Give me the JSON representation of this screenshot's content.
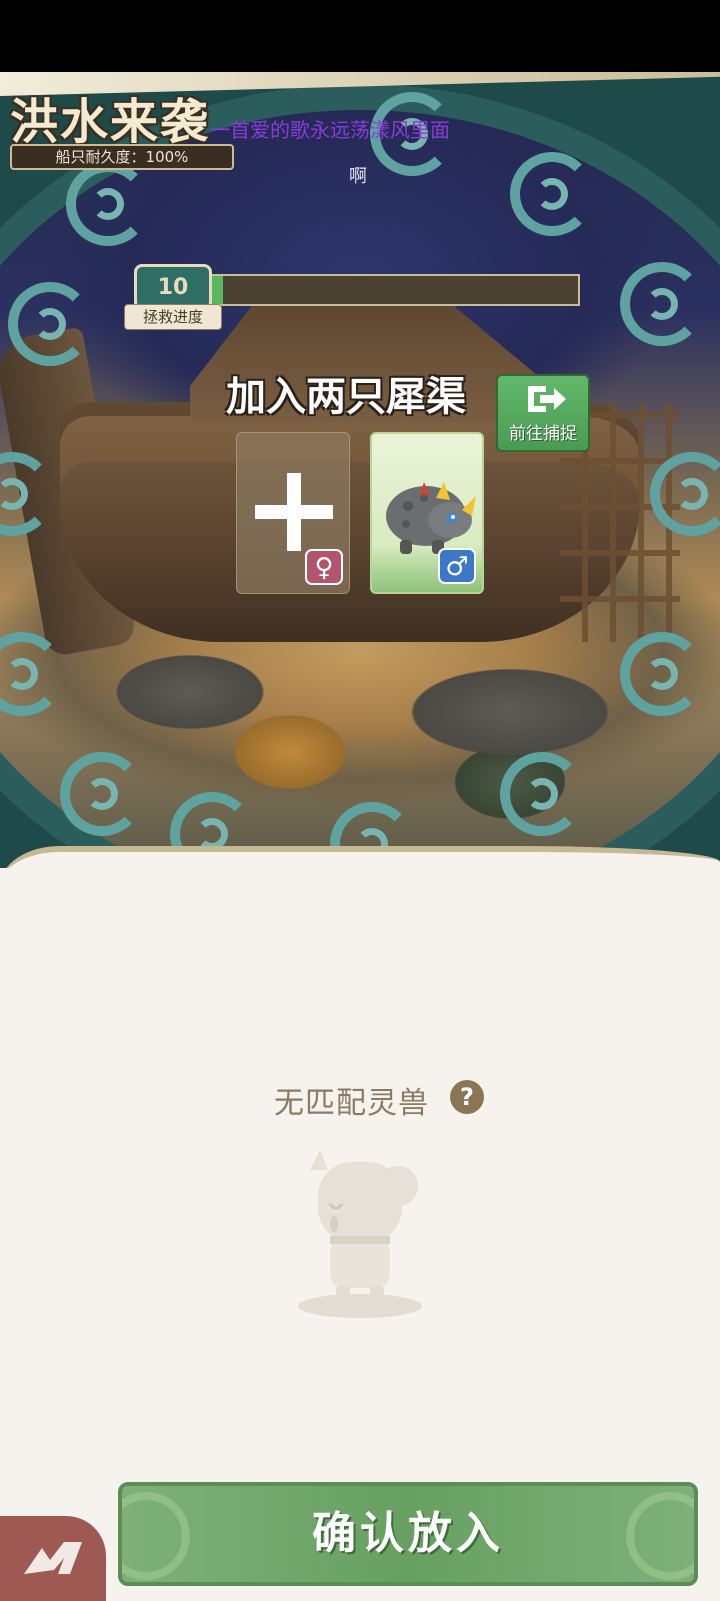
{
  "header": {
    "title": "洪水来袭",
    "lyric_line": "一首爱的歌永远荡漾风里面",
    "lyric_line_2": "啊",
    "durability": "船只耐久度：100%"
  },
  "progress": {
    "icon_text": "10",
    "label": "拯救进度",
    "value_fraction": 0.03
  },
  "join": {
    "title": "加入两只犀渠",
    "capture_label": "前往捕捉",
    "female_symbol": "♀",
    "male_symbol": "♂"
  },
  "panel": {
    "empty_text": "无匹配灵兽",
    "help_symbol": "?"
  },
  "footer": {
    "confirm_label": "确认放入"
  },
  "colors": {
    "frame": "#1f4a4a",
    "accent_green": "#63b86a",
    "female": "#b2546c",
    "male": "#3b78c8",
    "lyric": "#8a3ad6"
  }
}
